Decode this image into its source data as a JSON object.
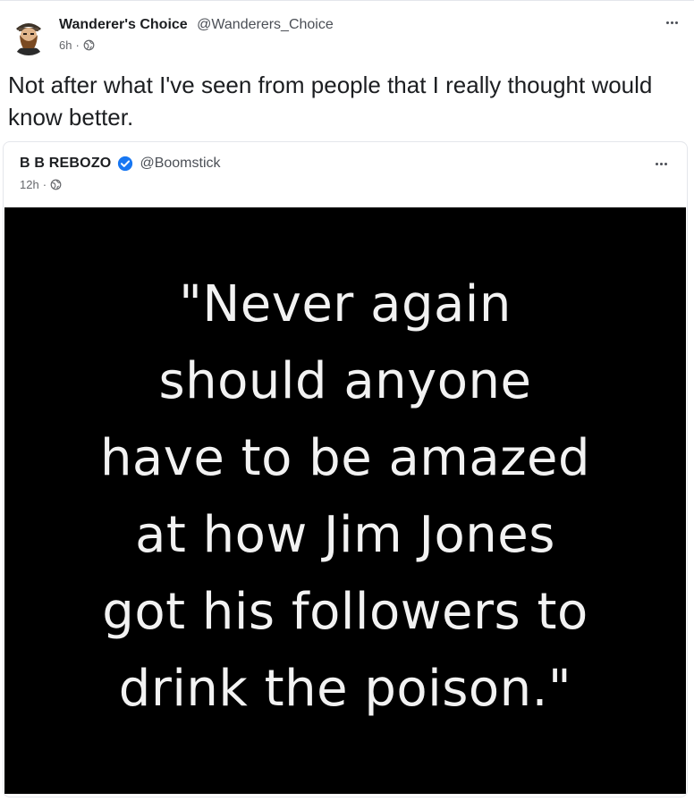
{
  "post": {
    "author_name": "Wanderer's Choice",
    "author_handle": "@Wanderers_Choice",
    "time": "6h",
    "separator": "·",
    "audience_icon": "globe-icon",
    "text": "Not after what I've seen from people that I really thought would know better."
  },
  "quoted_post": {
    "author_name": "B B REBOZO",
    "verified_icon": "verified-badge-icon",
    "author_handle": "@Boomstick",
    "time": "12h",
    "separator": "·",
    "audience_icon": "globe-icon",
    "image_text_lines": [
      "\"Never again",
      "should anyone",
      "have to be amazed",
      "at how Jim Jones",
      "got his followers to",
      "drink the poison.\""
    ]
  },
  "colors": {
    "verified_blue": "#1877f2",
    "image_background": "#000000"
  }
}
